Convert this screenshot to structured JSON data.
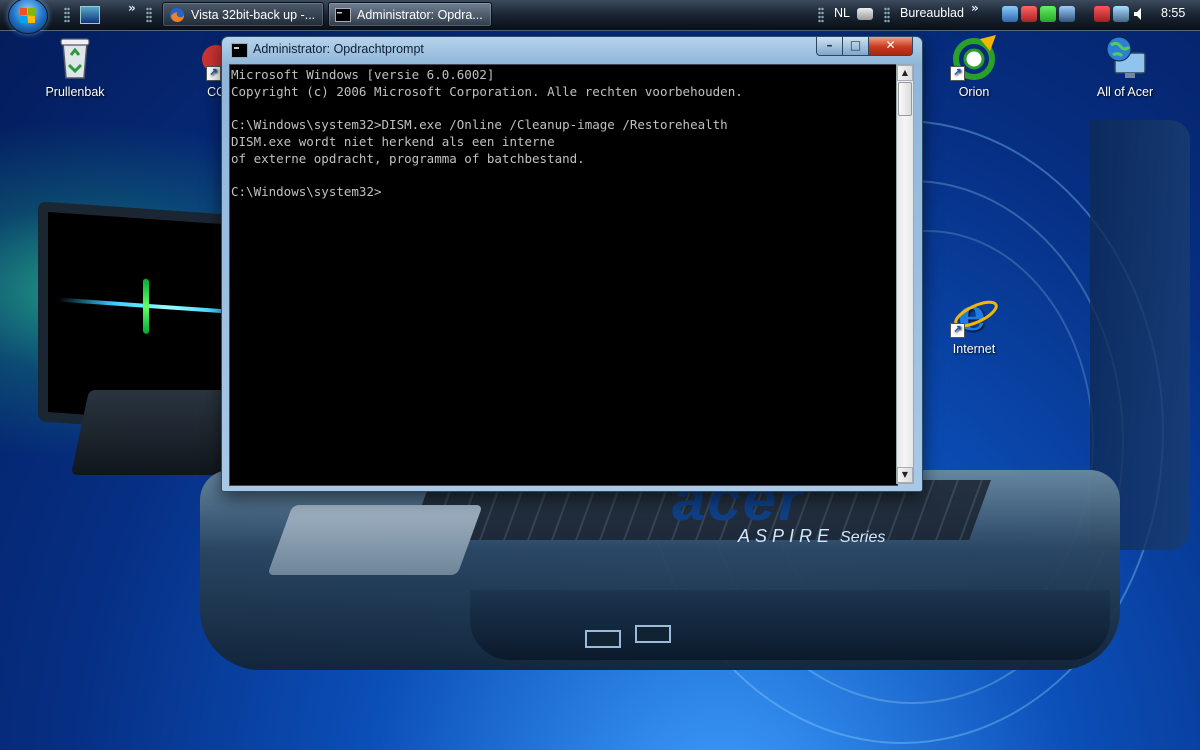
{
  "taskbar": {
    "overflow_chevron": "»",
    "buttons": [
      {
        "label": "Vista 32bit-back up -...",
        "icon": "firefox-icon"
      },
      {
        "label": "Administrator: Opdra...",
        "icon": "cmd-icon"
      }
    ],
    "language": "NL",
    "desktop_toolbar": "Bureaublad",
    "tray_chevron": "»",
    "clock": "8:55"
  },
  "desktop": {
    "icons": [
      {
        "label": "Prullenbak",
        "icon": "recycle-bin-icon"
      },
      {
        "label": "CCl",
        "icon": "ccleaner-icon"
      },
      {
        "label": "Orion",
        "icon": "orion-icon"
      },
      {
        "label": "All of Acer",
        "icon": "globe-monitor-icon"
      },
      {
        "label": "Internet",
        "icon": "internet-explorer-icon"
      }
    ],
    "wallpaper_brand": "acer",
    "wallpaper_series": "ASPIRE",
    "wallpaper_series_suffix": "Series"
  },
  "cmd_window": {
    "title": "Administrator: Opdrachtprompt",
    "minimize_label": "–",
    "maximize_label": "□",
    "close_label": "✕",
    "console_lines": "Microsoft Windows [versie 6.0.6002]\nCopyright (c) 2006 Microsoft Corporation. Alle rechten voorbehouden.\n\nC:\\Windows\\system32>DISM.exe /Online /Cleanup-image /Restorehealth\nDISM.exe wordt niet herkend als een interne\nof externe opdracht, programma of batchbestand.\n\nC:\\Windows\\system32>",
    "scroll_up": "▲",
    "scroll_down": "▼"
  },
  "colors": {
    "console_background": "#000000",
    "console_text": "#c0c0c0",
    "close_button": "#c8391c"
  }
}
